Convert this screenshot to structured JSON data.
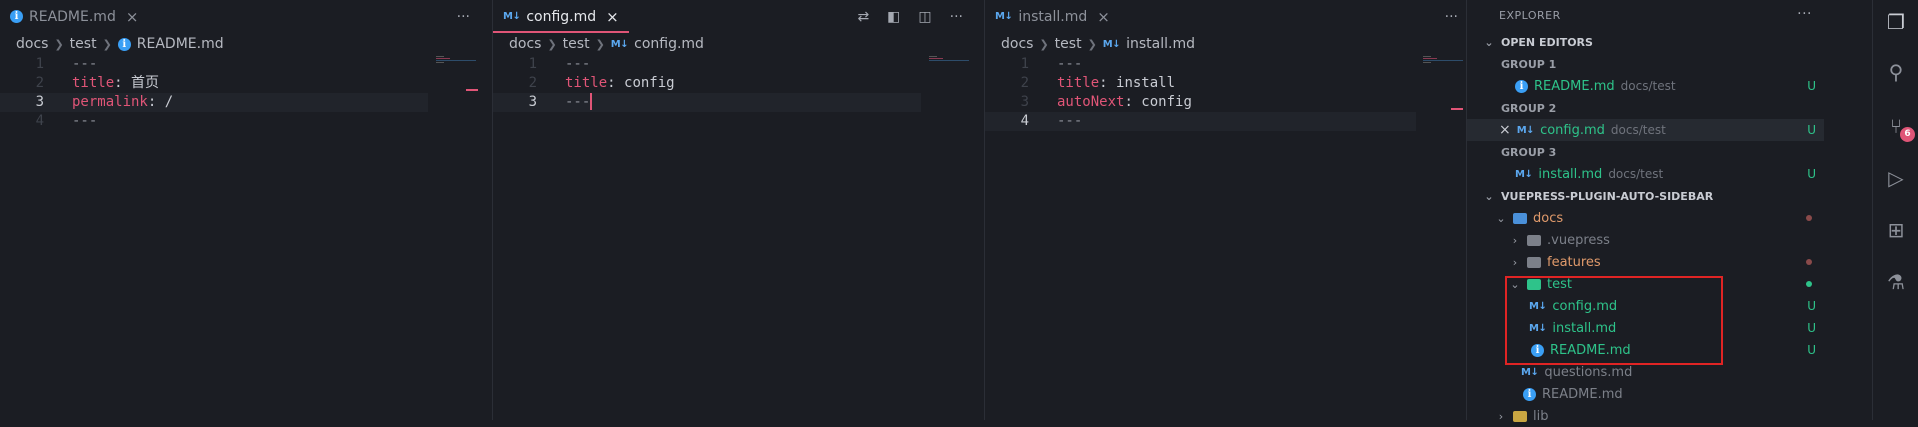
{
  "editors": [
    {
      "tab": {
        "label": "README.md",
        "close": "×"
      },
      "breadcrumb": [
        "docs",
        "test",
        "README.md"
      ],
      "actions": [
        "···"
      ],
      "lines": [
        {
          "num": "1",
          "parts": [
            {
              "t": "---",
              "c": "fm"
            }
          ]
        },
        {
          "num": "2",
          "parts": [
            {
              "t": "title",
              "c": "key"
            },
            {
              "t": ": 首页",
              "c": "val"
            }
          ]
        },
        {
          "num": "3",
          "parts": [
            {
              "t": "permalink",
              "c": "key"
            },
            {
              "t": ": /",
              "c": "val"
            }
          ]
        },
        {
          "num": "4",
          "parts": [
            {
              "t": "---",
              "c": "fm"
            }
          ]
        }
      ]
    },
    {
      "tab": {
        "label": "config.md",
        "close": "×"
      },
      "breadcrumb": [
        "docs",
        "test",
        "config.md"
      ],
      "actions": [
        "⇄",
        "◧",
        "◫",
        "···"
      ],
      "lines": [
        {
          "num": "1",
          "parts": [
            {
              "t": "---",
              "c": "fm"
            }
          ]
        },
        {
          "num": "2",
          "parts": [
            {
              "t": "title",
              "c": "key"
            },
            {
              "t": ": config",
              "c": "val"
            }
          ]
        },
        {
          "num": "3",
          "parts": [
            {
              "t": "---",
              "c": "fm"
            }
          ]
        }
      ]
    },
    {
      "tab": {
        "label": "install.md",
        "close": "×"
      },
      "breadcrumb": [
        "docs",
        "test",
        "install.md"
      ],
      "actions": [
        "···"
      ],
      "lines": [
        {
          "num": "1",
          "parts": [
            {
              "t": "---",
              "c": "fm"
            }
          ]
        },
        {
          "num": "2",
          "parts": [
            {
              "t": "title",
              "c": "key"
            },
            {
              "t": ": install",
              "c": "val"
            }
          ]
        },
        {
          "num": "3",
          "parts": [
            {
              "t": "autoNext",
              "c": "key"
            },
            {
              "t": ": config",
              "c": "val"
            }
          ]
        },
        {
          "num": "4",
          "parts": [
            {
              "t": "---",
              "c": "fm"
            }
          ]
        }
      ]
    }
  ],
  "explorer": {
    "title": "EXPLORER",
    "more": "···",
    "open_editors": {
      "label": "OPEN EDITORS",
      "groups": [
        {
          "label": "GROUP 1",
          "file": "README.md",
          "path": "docs/test",
          "status": "U"
        },
        {
          "label": "GROUP 2",
          "file": "config.md",
          "path": "docs/test",
          "status": "U"
        },
        {
          "label": "GROUP 3",
          "file": "install.md",
          "path": "docs/test",
          "status": "U"
        }
      ]
    },
    "workspace": {
      "label": "VUEPRESS-PLUGIN-AUTO-SIDEBAR",
      "docs": "docs",
      "vuepress": ".vuepress",
      "features": "features",
      "test": "test",
      "test_files": [
        {
          "name": "config.md",
          "status": "U"
        },
        {
          "name": "install.md",
          "status": "U"
        },
        {
          "name": "README.md",
          "status": "U"
        }
      ],
      "questions": "questions.md",
      "readme": "README.md",
      "lib": "lib"
    }
  },
  "activity": {
    "scm_badge": "6"
  },
  "colors": {
    "accent": "#e05577",
    "untracked": "#2ec38a",
    "highlight": "#e02424"
  }
}
